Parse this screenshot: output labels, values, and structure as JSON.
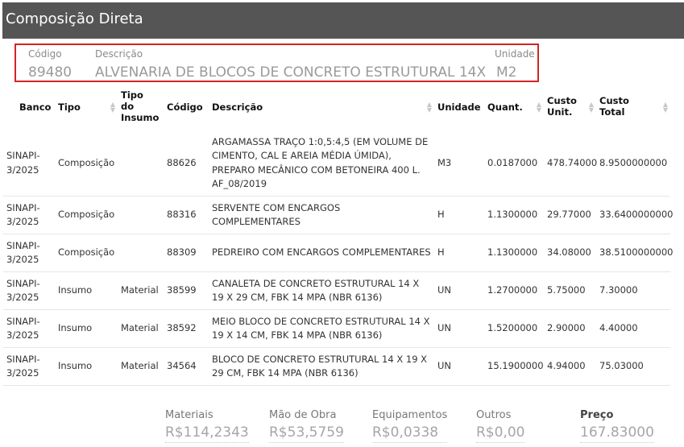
{
  "header": {
    "title": "Composição Direta"
  },
  "selection": {
    "codigo_label": "Código",
    "descricao_label": "Descrição",
    "unidade_label": "Unidade",
    "codigo_value": "89480",
    "descricao_value": "ALVENARIA DE BLOCOS DE CONCRETO ESTRUTURAL 14X",
    "unidade_value": "M2"
  },
  "table": {
    "headers": [
      "Banco",
      "Tipo",
      "Tipo do Insumo",
      "Código",
      "Descrição",
      "Unidade",
      "Quant.",
      "Custo Unit.",
      "Custo Total"
    ],
    "rows": [
      {
        "banco": "SINAPI-3/2025",
        "tipo": "Composição",
        "tipo_insumo": "",
        "codigo": "88626",
        "descricao": "ARGAMASSA TRAÇO 1:0,5:4,5 (EM VOLUME DE CIMENTO, CAL E AREIA MÉDIA ÚMIDA), PREPARO MECÂNICO COM BETONEIRA 400 L. AF_08/2019",
        "unidade": "M3",
        "quant": "0.0187000",
        "custo_unit": "478.74000",
        "custo_total": "8.9500000000"
      },
      {
        "banco": "SINAPI-3/2025",
        "tipo": "Composição",
        "tipo_insumo": "",
        "codigo": "88316",
        "descricao": "SERVENTE COM ENCARGOS COMPLEMENTARES",
        "unidade": "H",
        "quant": "1.1300000",
        "custo_unit": "29.77000",
        "custo_total": "33.6400000000"
      },
      {
        "banco": "SINAPI-3/2025",
        "tipo": "Composição",
        "tipo_insumo": "",
        "codigo": "88309",
        "descricao": "PEDREIRO COM ENCARGOS COMPLEMENTARES",
        "unidade": "H",
        "quant": "1.1300000",
        "custo_unit": "34.08000",
        "custo_total": "38.5100000000"
      },
      {
        "banco": "SINAPI-3/2025",
        "tipo": "Insumo",
        "tipo_insumo": "Material",
        "codigo": "38599",
        "descricao": "CANALETA DE CONCRETO ESTRUTURAL 14 X 19 X 29 CM, FBK 14 MPA (NBR 6136)",
        "unidade": "UN",
        "quant": "1.2700000",
        "custo_unit": "5.75000",
        "custo_total": "7.30000"
      },
      {
        "banco": "SINAPI-3/2025",
        "tipo": "Insumo",
        "tipo_insumo": "Material",
        "codigo": "38592",
        "descricao": "MEIO BLOCO DE CONCRETO ESTRUTURAL 14 X 19 X 14 CM, FBK 14 MPA (NBR 6136)",
        "unidade": "UN",
        "quant": "1.5200000",
        "custo_unit": "2.90000",
        "custo_total": "4.40000"
      },
      {
        "banco": "SINAPI-3/2025",
        "tipo": "Insumo",
        "tipo_insumo": "Material",
        "codigo": "34564",
        "descricao": "BLOCO DE CONCRETO ESTRUTURAL 14 X 19 X 29 CM, FBK 14 MPA (NBR 6136)",
        "unidade": "UN",
        "quant": "15.1900000",
        "custo_unit": "4.94000",
        "custo_total": "75.03000"
      }
    ]
  },
  "summary": {
    "materiais_label": "Materiais",
    "materiais_value": "R$114,2343",
    "mao_obra_label": "Mão de Obra",
    "mao_obra_value": "R$53,5759",
    "equipamentos_label": "Equipamentos",
    "equipamentos_value": "R$0,0338",
    "outros_label": "Outros",
    "outros_value": "R$0,00",
    "preco_label": "Preço",
    "preco_value": "167.83000"
  }
}
